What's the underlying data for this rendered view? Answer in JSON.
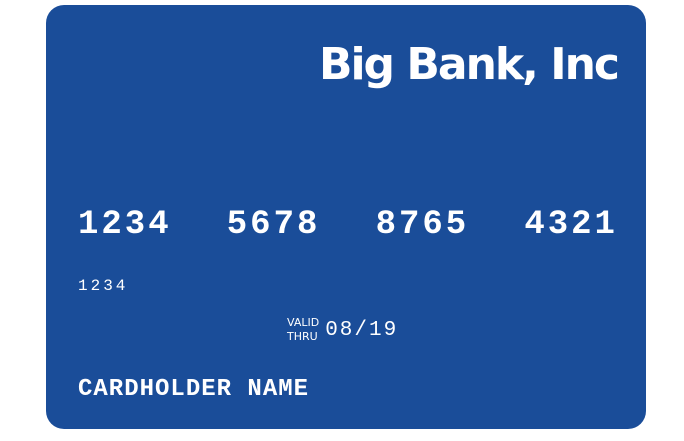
{
  "colors": {
    "card_background": "#1a4d99",
    "text": "#ffffff",
    "page_background": "#ffffff"
  },
  "card": {
    "bank_name": "Big Bank, Inc",
    "number_groups": [
      "1234",
      "5678",
      "8765",
      "4321"
    ],
    "small_number": "1234",
    "valid_label_line1": "VALID",
    "valid_label_line2": "THRU",
    "valid_thru": "08/19",
    "cardholder_name": "CARDHOLDER NAME"
  }
}
